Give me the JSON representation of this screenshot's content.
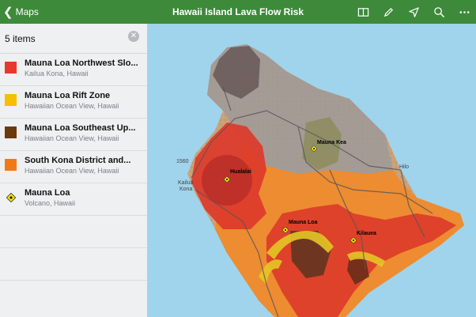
{
  "nav": {
    "back_label": "Maps",
    "title": "Hawaii Island Lava Flow Risk"
  },
  "toolbar_icons": [
    "book-icon",
    "pencil-icon",
    "location-arrow-icon",
    "search-icon",
    "more-icon"
  ],
  "sidebar": {
    "count_label": "5 items",
    "items": [
      {
        "name": "Mauna Loa Northwest Slo...",
        "subtitle": "Kailua Kona, Hawaii",
        "color": "#e8382b"
      },
      {
        "name": "Mauna Loa Rift Zone",
        "subtitle": "Hawaiian Ocean View, Hawaii",
        "color": "#f6c000"
      },
      {
        "name": "Mauna Loa Southeast Up...",
        "subtitle": "Hawaiian Ocean View, Hawaii",
        "color": "#6b3a0e"
      },
      {
        "name": "South Kona District and...",
        "subtitle": "Hawaiian Ocean View, Hawaii",
        "color": "#f07b16"
      },
      {
        "name": "Mauna Loa",
        "subtitle": "Volcano, Hawaii",
        "color": "#f6e000"
      }
    ]
  },
  "map": {
    "labels": {
      "mauna_kea": "Mauna Kea",
      "hualalai": "Hualalai",
      "mauna_loa": "Mauna Loa",
      "kilauea": "Kilauea",
      "kailua": "Kailua",
      "kona": "Kona",
      "hilo": "Hilo",
      "road_num": "1560"
    }
  }
}
